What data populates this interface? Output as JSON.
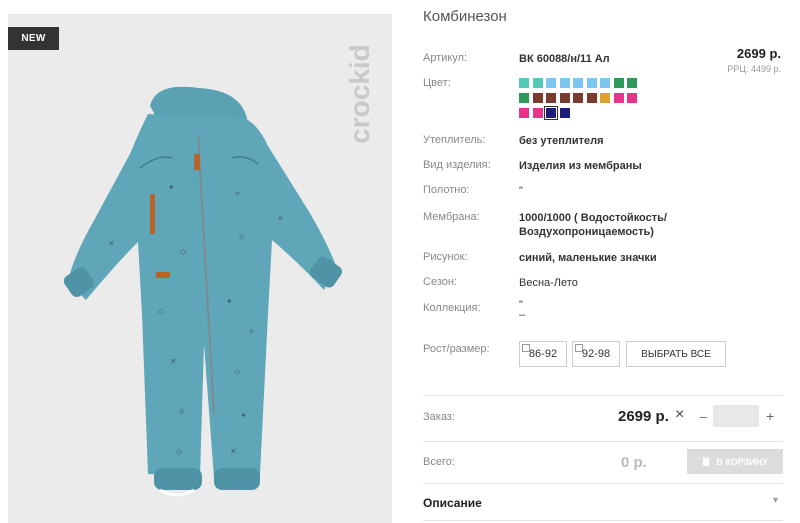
{
  "badge": "NEW",
  "brand": "crockid",
  "product": {
    "title": "Комбинезон",
    "price": "2699 р.",
    "rrc": "РРЦ: 4499 р."
  },
  "specs": [
    {
      "label": "Артикул:",
      "value": "ВК 60088/н/11 Ал"
    },
    {
      "label": "Цвет:",
      "value": ""
    },
    {
      "label": "Утеплитель:",
      "value": "без утеплителя"
    },
    {
      "label": "Вид изделия:",
      "value": "Изделия из мембраны"
    },
    {
      "label": "Полотно:",
      "value": "\""
    },
    {
      "label": "Мембрана:",
      "value": "1000/1000 ( Водостойкость/"
    },
    {
      "label": "",
      "value": "Воздухопроницаемость)"
    },
    {
      "label": "Рисунок:",
      "value": "синий, маленькие значки"
    },
    {
      "label": "Сезон:",
      "value": "Весна-Лето"
    },
    {
      "label": "Коллекция:",
      "value": "\""
    },
    {
      "label": "",
      "value": "–"
    }
  ],
  "swatch_colors": [
    "#52c9b5",
    "#52c9b5",
    "#7cc6f2",
    "#7cc6f2",
    "#7cc6f2",
    "#7cc6f2",
    "#7cc6f2",
    "#2e9a5a",
    "#2e9a5a",
    "#2e9a5a",
    "#7a3b2e",
    "#7a3b2e",
    "#7a3b2e",
    "#7a3b2e",
    "#7a3b2e",
    "#e0a030",
    "#e8338a",
    "#e8338a",
    "#e8338a",
    "#e8338a",
    "#1c1c7a",
    "#1c1c7a"
  ],
  "selected_swatch": 20,
  "size": {
    "label": "Рост/размер:",
    "options": [
      "86-92",
      "92-98"
    ],
    "select_all": "ВЫБРАТЬ ВСЕ"
  },
  "order": {
    "label": "Заказ:",
    "price": "2699 р.",
    "remove_icon": "×",
    "minus": "–",
    "plus": "+"
  },
  "total": {
    "label": "Всего:",
    "value": "0 р.",
    "cart_button": "В КОРЗИНУ"
  },
  "description": {
    "label": "Описание",
    "chevron": "▾"
  }
}
